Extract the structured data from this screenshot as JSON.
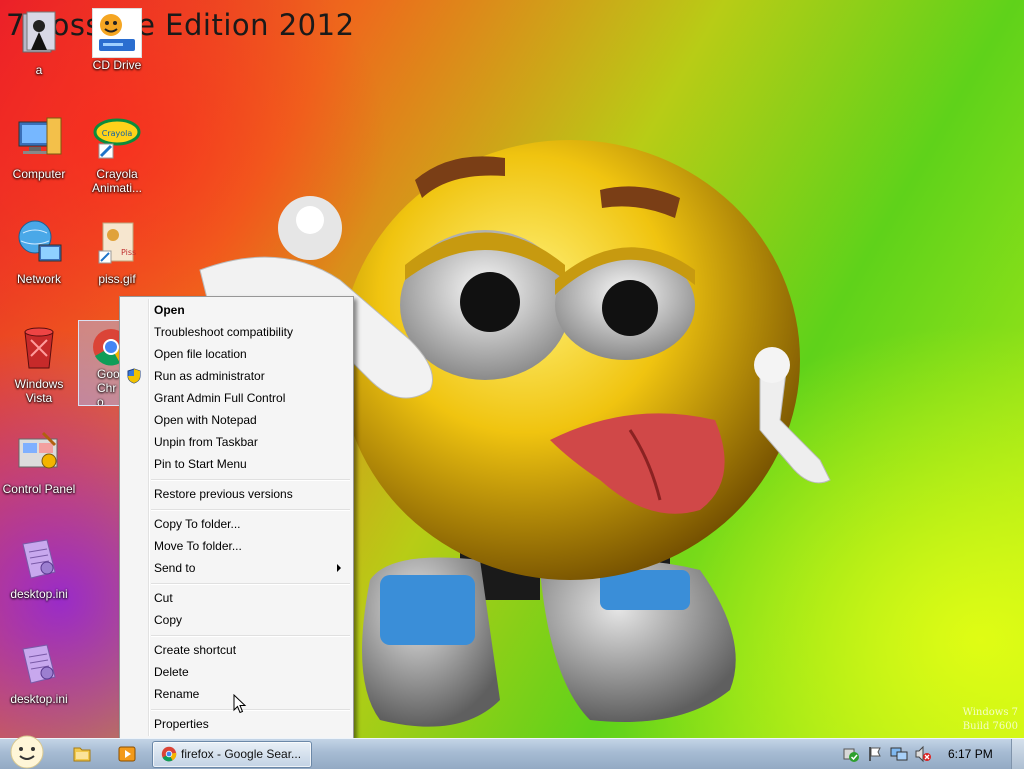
{
  "wallpaper": {
    "title": "7 Possible Edition 2012",
    "watermark_line1": "Windows 7",
    "watermark_line2": "Build 7600"
  },
  "desktop_icons": [
    {
      "label": "a",
      "icon": "book-figure-icon"
    },
    {
      "label": "CD Drive",
      "icon": "cd-drive-icon"
    },
    {
      "label": "Computer",
      "icon": "computer-icon"
    },
    {
      "label": "Crayola Animati...",
      "icon": "crayola-icon"
    },
    {
      "label": "Network",
      "icon": "network-globe-icon"
    },
    {
      "label": "piss.gif",
      "icon": "gif-image-icon"
    },
    {
      "label": "Windows Vista",
      "icon": "recycle-bin-icon"
    },
    {
      "label": "Goo Chro",
      "icon": "chrome-icon"
    },
    {
      "label": "Control Panel",
      "icon": "control-panel-icon"
    },
    {
      "label": "desktop.ini",
      "icon": "ini-file-icon"
    },
    {
      "label": "desktop.ini",
      "icon": "ini-file-icon"
    }
  ],
  "context_menu": {
    "items": [
      {
        "label": "Open"
      },
      {
        "label": "Troubleshoot compatibility"
      },
      {
        "label": "Open file location"
      },
      {
        "label": "Run as administrator"
      },
      {
        "label": "Grant Admin Full Control"
      },
      {
        "label": "Open with Notepad"
      },
      {
        "label": "Unpin from Taskbar"
      },
      {
        "label": "Pin to Start Menu"
      },
      {
        "label": "Restore previous versions"
      },
      {
        "label": "Copy To folder..."
      },
      {
        "label": "Move To folder..."
      },
      {
        "label": "Send to"
      },
      {
        "label": "Cut"
      },
      {
        "label": "Copy"
      },
      {
        "label": "Create shortcut"
      },
      {
        "label": "Delete"
      },
      {
        "label": "Rename"
      },
      {
        "label": "Properties"
      }
    ]
  },
  "taskbar": {
    "active_window": "firefox - Google Sear...",
    "clock": "6:17 PM"
  },
  "colors": {
    "menu_bg": "#f5f5f5",
    "taskbar": "#a6bbd3",
    "selection": "#aac8ff"
  }
}
